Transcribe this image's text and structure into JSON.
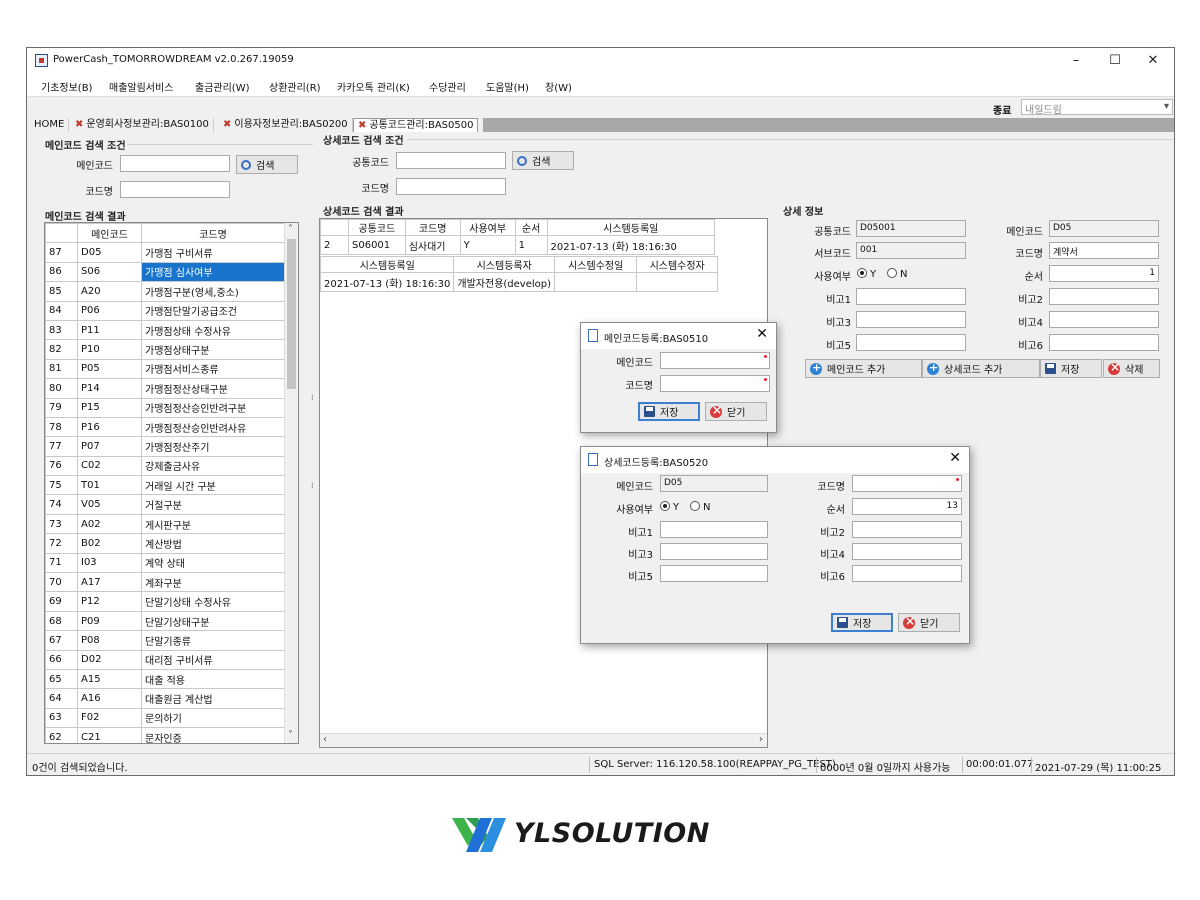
{
  "window": {
    "title": "PowerCash_TOMORROWDREAM v2.0.267.19059",
    "controls": [
      "–",
      "☐",
      "✕"
    ]
  },
  "menu": [
    "기초정보(B)",
    "매출알림서비스",
    "출금관리(W)",
    "상환관리(R)",
    "카카오톡 관리(K)",
    "수당관리",
    "도움말(H)",
    "창(W)"
  ],
  "toolbar": {
    "label": "종료",
    "combo": "내일드림"
  },
  "tabs": [
    {
      "label": "HOME"
    },
    {
      "label": "운영회사정보관리:BAS0100"
    },
    {
      "label": "이용자정보관리:BAS0200"
    },
    {
      "label": "공통코드관리:BAS0500"
    }
  ],
  "left": {
    "search_group": "메인코드 검색 조건",
    "main_code_label": "메인코드",
    "code_name_label": "코드명",
    "search_button": "검색",
    "results_group": "메인코드 검색 결과",
    "columns": [
      "메인코드",
      "코드명"
    ],
    "rows": [
      [
        "87",
        "D05",
        "가맹점 구비서류"
      ],
      [
        "86",
        "S06",
        "가맹점 심사여부"
      ],
      [
        "85",
        "A20",
        "가맹점구분(영세,중소)"
      ],
      [
        "84",
        "P06",
        "가맹점단말기공급조건"
      ],
      [
        "83",
        "P11",
        "가맹점상태 수정사유"
      ],
      [
        "82",
        "P10",
        "가맹점상태구분"
      ],
      [
        "81",
        "P05",
        "가맹점서비스종류"
      ],
      [
        "80",
        "P14",
        "가맹점정산상태구분"
      ],
      [
        "79",
        "P15",
        "가맹점정산승인반려구분"
      ],
      [
        "78",
        "P16",
        "가맹점정산승인반려사유"
      ],
      [
        "77",
        "P07",
        "가맹점정산주기"
      ],
      [
        "76",
        "C02",
        "강제출금사유"
      ],
      [
        "75",
        "T01",
        "거래일 시간 구분"
      ],
      [
        "74",
        "V05",
        "거절구분"
      ],
      [
        "73",
        "A02",
        "게시판구분"
      ],
      [
        "72",
        "B02",
        "계산방법"
      ],
      [
        "71",
        "I03",
        "계약 상태"
      ],
      [
        "70",
        "A17",
        "계좌구분"
      ],
      [
        "69",
        "P12",
        "단말기상태 수정사유"
      ],
      [
        "68",
        "P09",
        "단말기상태구분"
      ],
      [
        "67",
        "P08",
        "단말기종류"
      ],
      [
        "66",
        "D02",
        "대리점 구비서류"
      ],
      [
        "65",
        "A15",
        "대출 적용"
      ],
      [
        "64",
        "A16",
        "대출원금 계산법"
      ],
      [
        "63",
        "F02",
        "문의하기"
      ],
      [
        "62",
        "C21",
        "문자인증"
      ]
    ],
    "selected_index": 1
  },
  "middle": {
    "search_group": "상세코드 검색 조건",
    "common_code_label": "공통코드",
    "code_name_label": "코드명",
    "search_button": "검색",
    "results_group": "상세코드 검색 결과",
    "columns": [
      "공통코드",
      "코드명",
      "사용여부",
      "순서",
      "시스템등록일"
    ],
    "row": [
      "2",
      "S06001",
      "심사대기",
      "Y",
      "1",
      "2021-07-13 (화) 18:16:30"
    ],
    "sub_columns": [
      "시스템등록일",
      "시스템등록자",
      "시스템수정일",
      "시스템수정자"
    ],
    "sub_row": [
      "2021-07-13 (화) 18:16:30",
      "개발자전용(develop)",
      "",
      ""
    ]
  },
  "detail": {
    "group": "상세 정보",
    "common_code_label": "공통코드",
    "common_code": "D05001",
    "main_code_label": "메인코드",
    "main_code": "D05",
    "sub_code_label": "서브코드",
    "sub_code": "001",
    "code_name_label": "코드명",
    "code_name": "계약서",
    "use_label": "사용여부",
    "yes": "Y",
    "no": "N",
    "order_label": "순서",
    "order": "1",
    "note1": "비고1",
    "note2": "비고2",
    "note3": "비고3",
    "note4": "비고4",
    "note5": "비고5",
    "note6": "비고6",
    "add_main": "메인코드 추가",
    "add_detail": "상세코드 추가",
    "save": "저장",
    "delete": "삭제"
  },
  "dialog1": {
    "title": "메인코드등록:BAS0510",
    "main_code_label": "메인코드",
    "code_name_label": "코드명",
    "save": "저장",
    "close": "닫기"
  },
  "dialog2": {
    "title": "상세코드등록:BAS0520",
    "main_code_label": "메인코드",
    "main_code": "D05",
    "code_name_label": "코드명",
    "use_label": "사용여부",
    "yes": "Y",
    "no": "N",
    "order_label": "순서",
    "order": "13",
    "note1": "비고1",
    "note2": "비고2",
    "note3": "비고3",
    "note4": "비고4",
    "note5": "비고5",
    "note6": "비고6",
    "save": "저장",
    "close": "닫기"
  },
  "status": {
    "message": "0건이 검색되었습니다.",
    "server": "SQL Server: 116.120.58.100(REAPPAY_PG_TEST)",
    "license": "0000년 0월 0일까지 사용가능",
    "elapsed": "00:00:01.077",
    "datetime": "2021-07-29 (목) 11:00:25"
  },
  "brand": {
    "name": "YLSOLUTION",
    "color_green": "#3cb44a",
    "color_blue": "#1f6fd6"
  }
}
